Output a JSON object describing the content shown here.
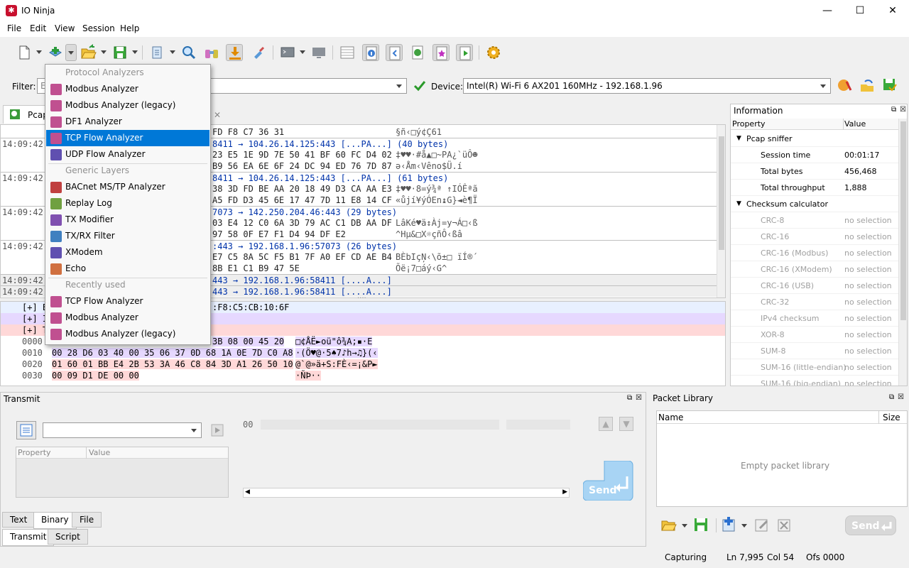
{
  "window": {
    "title": "IO Ninja",
    "min": "—",
    "max": "☐",
    "close": "✕"
  },
  "menu": [
    "File",
    "Edit",
    "View",
    "Session",
    "Help"
  ],
  "filter": {
    "label": "Filter:",
    "value": "E"
  },
  "device": {
    "label": "Device:",
    "value": "Intel(R) Wi-Fi 6 AX201 160MHz - 192.168.1.96"
  },
  "log_tab": {
    "label": "Pcap",
    "close": "✕"
  },
  "log_rows": [
    {
      "ts": "",
      "hex": "FD F8 C7 36 31",
      "ascii": "§ñ‹□ý¢Ç61"
    },
    {
      "ts": "14:09:42",
      "hdr": "8411 → 104.26.14.125:443 [...PA...] (40 bytes)"
    },
    {
      "ts": "",
      "hex": "23 E5 1E 9D 7E 50 41 BF 60 FC D4 02",
      "ascii": "‡♥♥·#å▲□~PA¿`üÔ☻"
    },
    {
      "ts": "",
      "hex": "B9 56 EA 6E 6F 24 DC 94 ED 76 7D 87",
      "ascii": "ə‹Åm‹Vêno$Ü.í"
    },
    {
      "ts": "14:09:42",
      "hdr": "8411 → 104.26.14.125:443 [...PA...] (61 bytes)"
    },
    {
      "ts": "",
      "hex": "38 3D FD BE AA 20 18 49 D3 CA AA E3",
      "ascii": "‡♥♥·8=ý¾ª ↑IÓÊªã"
    },
    {
      "ts": "",
      "hex": "A5 FD D3 45 6E 17 47 7D 11 E8 14 CF",
      "ascii": "«ůjí¥ýÓEn↨G}◄è¶Ï"
    },
    {
      "ts": "14:09:42",
      "hdr": "7073 → 142.250.204.46:443 (29 bytes)"
    },
    {
      "ts": "",
      "hex": "03 E4 12 C0 6A 3D 79 AC C1 DB AA DF",
      "ascii": "LâKé♥ä↕Àj=y¬Á□‹ß"
    },
    {
      "ts": "",
      "hex": "97 58 0F E7 F1 D4 94 DF E2",
      "ascii": "^Hµ&□X☼çñÔ‹ßâ"
    },
    {
      "ts": "14:09:42",
      "hdr": ":443 → 192.168.1.96:57073 (26 bytes)"
    },
    {
      "ts": "",
      "hex": "E7 C5 8A 5C F5 B1 7F A0 EF CD AE B4",
      "ascii": "BÈbIçŅ‹\\õ±□ ïÍ®´"
    },
    {
      "ts": "",
      "hex": "8B E1 C1 B9 47 5E",
      "ascii": "Õë¡7□áý‹G^"
    },
    {
      "ts": "14:09:42",
      "hdr": "443 → 192.168.1.96:58411 [....A...]"
    },
    {
      "ts": "14:09:42",
      "hdr": "443 → 192.168.1.96:58411 [....A...]"
    }
  ],
  "packet": {
    "rows": [
      {
        "off": "",
        "text": "[+] E",
        "extra": ":F8:C5:CB:10:6F"
      },
      {
        "off": "",
        "text": "[+] I",
        "extra": ""
      },
      {
        "off": "",
        "text": "[+] T",
        "extra": ""
      }
    ],
    "hex": [
      {
        "off": "0000",
        "hex": "3B 08 00 45 20",
        "ascii": "□¢ÅË►oü\"ô¾A;▪·E"
      },
      {
        "off": "0010",
        "hex": "00 28 D6 03 40 00 35 06 37 0D 68 1A 0E 7D C0 A8",
        "ascii": "·(Ö♥@·5♠7♪h→♫}(‹"
      },
      {
        "off": "0020",
        "hex": "01 60 01 BB E4 2B 53 3A 46 C8 84 3D A1 26 50 10",
        "ascii": "@`@»ä+S:FÈ‹=¡&P►"
      },
      {
        "off": "0030",
        "hex": "00 09 D1 DE 00 00",
        "ascii": "·ÑÞ··"
      }
    ]
  },
  "info": {
    "title": "Information",
    "col_property": "Property",
    "col_value": "Value",
    "groups": [
      {
        "name": "Pcap sniffer",
        "rows": [
          {
            "p": "Session time",
            "v": "00:01:17"
          },
          {
            "p": "Total bytes",
            "v": "456,468"
          },
          {
            "p": "Total throughput",
            "v": "1,888"
          }
        ]
      },
      {
        "name": "Checksum calculator",
        "rows": [
          {
            "p": "CRC-8",
            "v": "no selection"
          },
          {
            "p": "CRC-16",
            "v": "no selection"
          },
          {
            "p": "CRC-16 (Modbus)",
            "v": "no selection"
          },
          {
            "p": "CRC-16 (XModem)",
            "v": "no selection"
          },
          {
            "p": "CRC-16 (USB)",
            "v": "no selection"
          },
          {
            "p": "CRC-32",
            "v": "no selection"
          },
          {
            "p": "IPv4 checksum",
            "v": "no selection"
          },
          {
            "p": "XOR-8",
            "v": "no selection"
          },
          {
            "p": "SUM-8",
            "v": "no selection"
          },
          {
            "p": "SUM-16 (little-endian)",
            "v": "no selection"
          },
          {
            "p": "SUM-16 (big-endian)",
            "v": "no selection"
          }
        ]
      }
    ]
  },
  "transmit": {
    "title": "Transmit",
    "offset": "00",
    "col_property": "Property",
    "col_value": "Value",
    "send": "Send",
    "tabs": [
      "Text",
      "Binary",
      "File"
    ],
    "bottom_tabs": [
      "Transmit",
      "Script"
    ]
  },
  "library": {
    "title": "Packet Library",
    "col_name": "Name",
    "col_size": "Size",
    "empty": "Empty packet library",
    "send": "Send"
  },
  "status": {
    "state": "Capturing",
    "ln": "Ln 7,995",
    "col": "Col 54",
    "ofs": "Ofs 0000"
  },
  "dropdown": {
    "sections": [
      {
        "title": "Protocol Analyzers",
        "items": [
          "Modbus Analyzer",
          "Modbus Analyzer (legacy)",
          "DF1 Analyzer",
          "TCP Flow Analyzer",
          "UDP Flow Analyzer"
        ]
      },
      {
        "title": "Generic Layers",
        "items": [
          "BACnet MS/TP Analyzer",
          "Replay Log",
          "TX Modifier",
          "TX/RX Filter",
          "XModem",
          "Echo"
        ]
      },
      {
        "title": "Recently used",
        "items": [
          "TCP Flow Analyzer",
          "Modbus Analyzer",
          "Modbus Analyzer (legacy)"
        ]
      }
    ],
    "selected": "TCP Flow Analyzer"
  },
  "colors": {
    "accent": "#0078d7",
    "brand": "#c8102e",
    "rx": "#d9d9ff",
    "tx": "#ffd9d9"
  }
}
